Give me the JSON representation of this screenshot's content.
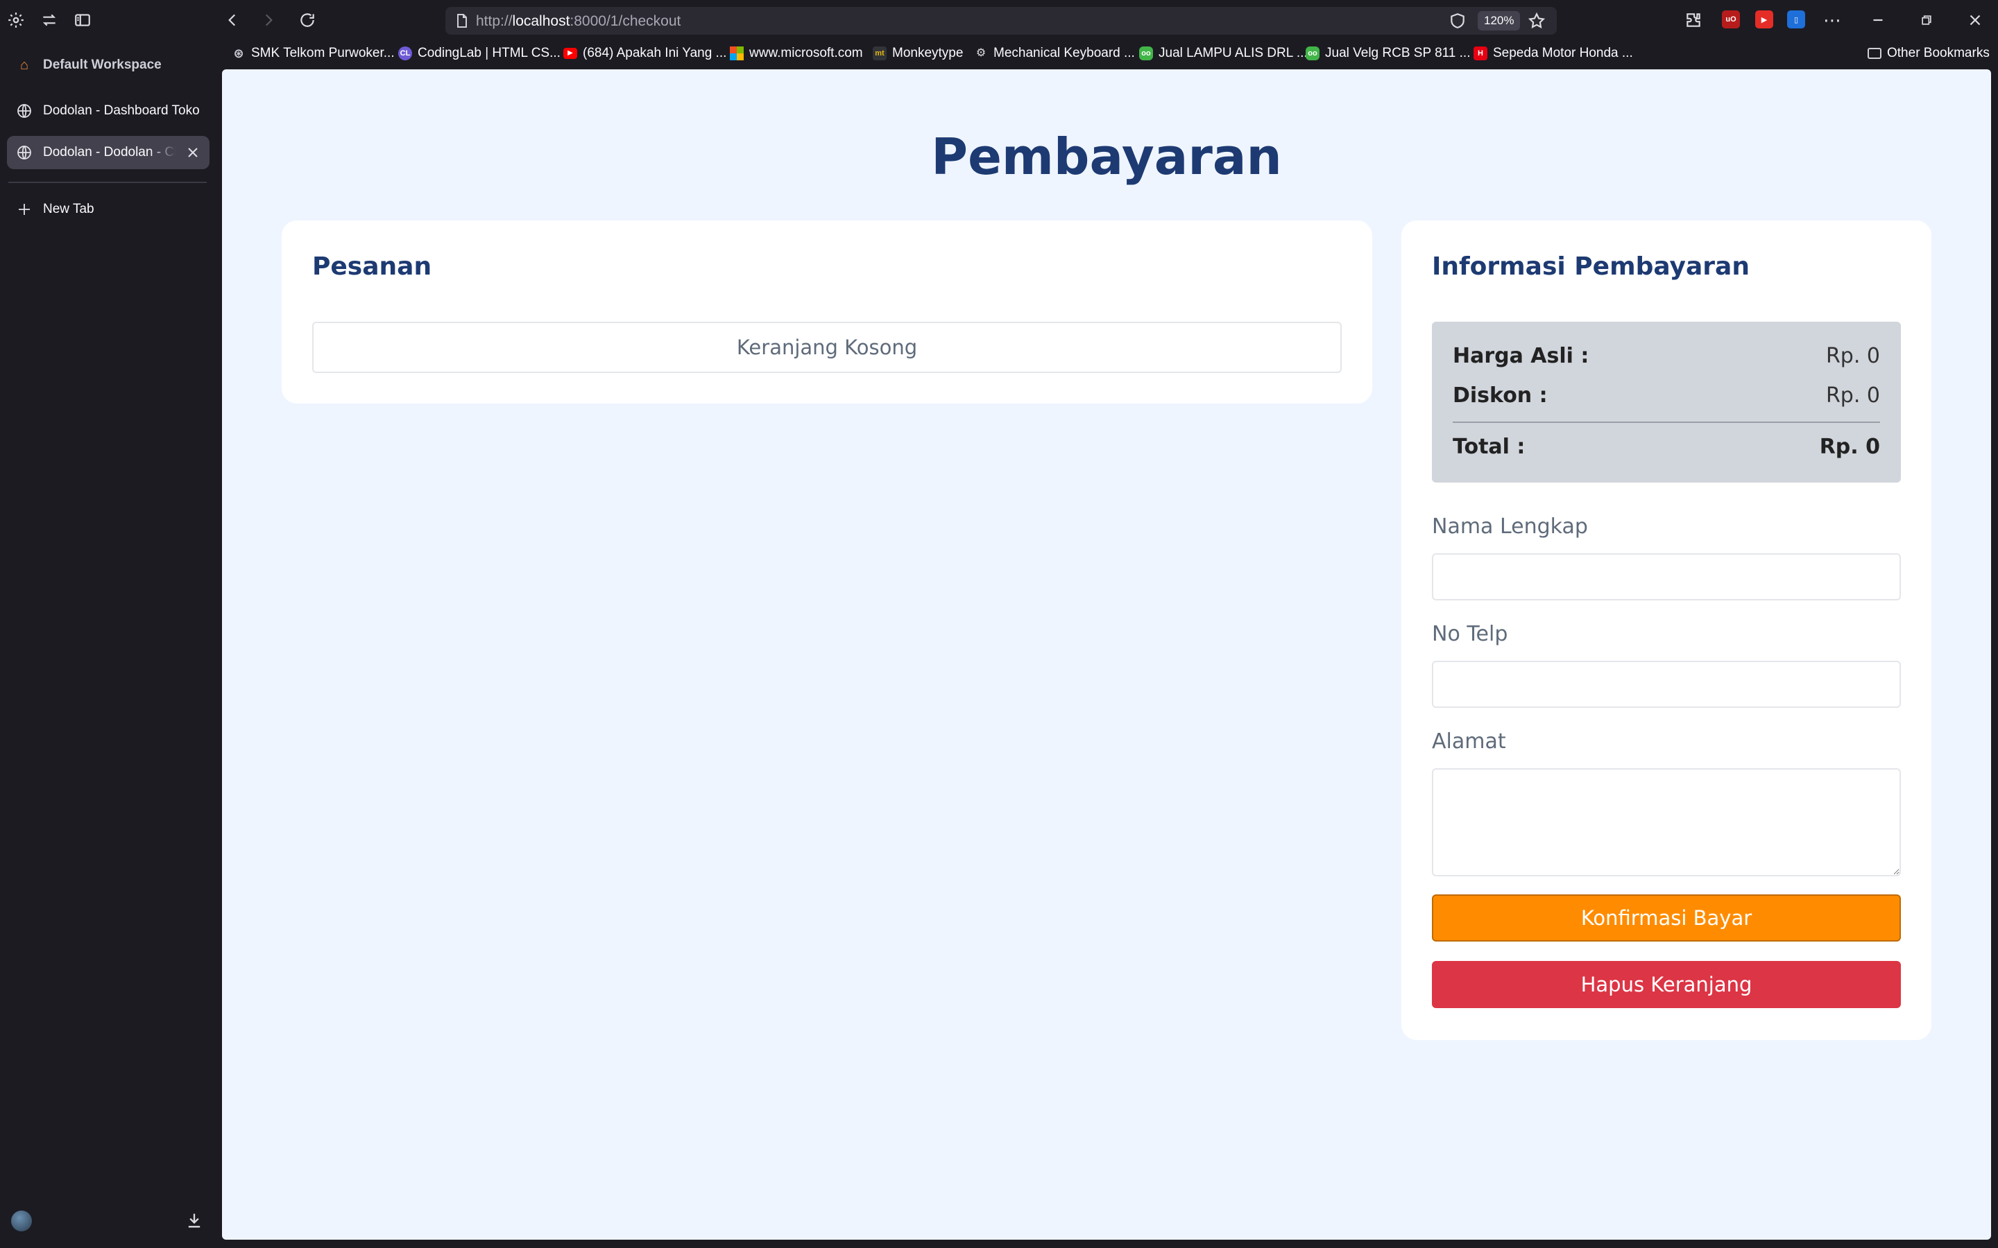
{
  "browser": {
    "url_scheme": "http://",
    "url_host": "localhost",
    "url_rest": ":8000/1/checkout",
    "zoom": "120%"
  },
  "bookmarks": [
    {
      "label": "SMK Telkom Purwoker...",
      "icon": "globe-icon",
      "color": "#9aa0a8"
    },
    {
      "label": "CodingLab | HTML CS...",
      "icon": "codinglab-icon",
      "color": "#6f5bd6"
    },
    {
      "label": "(684) Apakah Ini Yang ...",
      "icon": "youtube-icon",
      "color": "#ff0000"
    },
    {
      "label": "www.microsoft.com",
      "icon": "microsoft-icon",
      "color": "#00a4ef"
    },
    {
      "label": "Monkeytype",
      "icon": "monkeytype-icon",
      "color": "#e2b714"
    },
    {
      "label": "Mechanical Keyboard ...",
      "icon": "keyboard-site-icon",
      "color": "#bbbbbb"
    },
    {
      "label": "Jual LAMPU ALIS DRL ...",
      "icon": "tokopedia-icon",
      "color": "#42b549"
    },
    {
      "label": "Jual Velg RCB SP 811 ...",
      "icon": "tokopedia-icon",
      "color": "#42b549"
    },
    {
      "label": "Sepeda Motor Honda ...",
      "icon": "honda-icon",
      "color": "#e60012"
    }
  ],
  "other_bookmarks": "Other Bookmarks",
  "sidebar": {
    "workspace": "Default Workspace",
    "tabs": [
      {
        "label": "Dodolan - Dashboard Toko"
      },
      {
        "label": "Dodolan - Dodolan - Checkout"
      }
    ],
    "new_tab": "New Tab"
  },
  "page": {
    "title": "Pembayaran",
    "order": {
      "heading": "Pesanan",
      "empty_text": "Keranjang Kosong"
    },
    "payment": {
      "heading": "Informasi Pembayaran",
      "summary": {
        "original_label": "Harga Asli :",
        "original_value": "Rp. 0",
        "discount_label": "Diskon :",
        "discount_value": "Rp. 0",
        "total_label": "Total :",
        "total_value": "Rp. 0"
      },
      "fields": {
        "name_label": "Nama Lengkap",
        "name_value": "",
        "phone_label": "No Telp",
        "phone_value": "",
        "address_label": "Alamat",
        "address_value": ""
      },
      "confirm_label": "Konfirmasi Bayar",
      "clear_label": "Hapus Keranjang"
    }
  },
  "colors": {
    "page_bg": "#eff5ff",
    "heading": "#1d3a72",
    "confirm": "#ff8c00",
    "clear": "#dc3545",
    "summary_bg": "#d1d5dc"
  }
}
